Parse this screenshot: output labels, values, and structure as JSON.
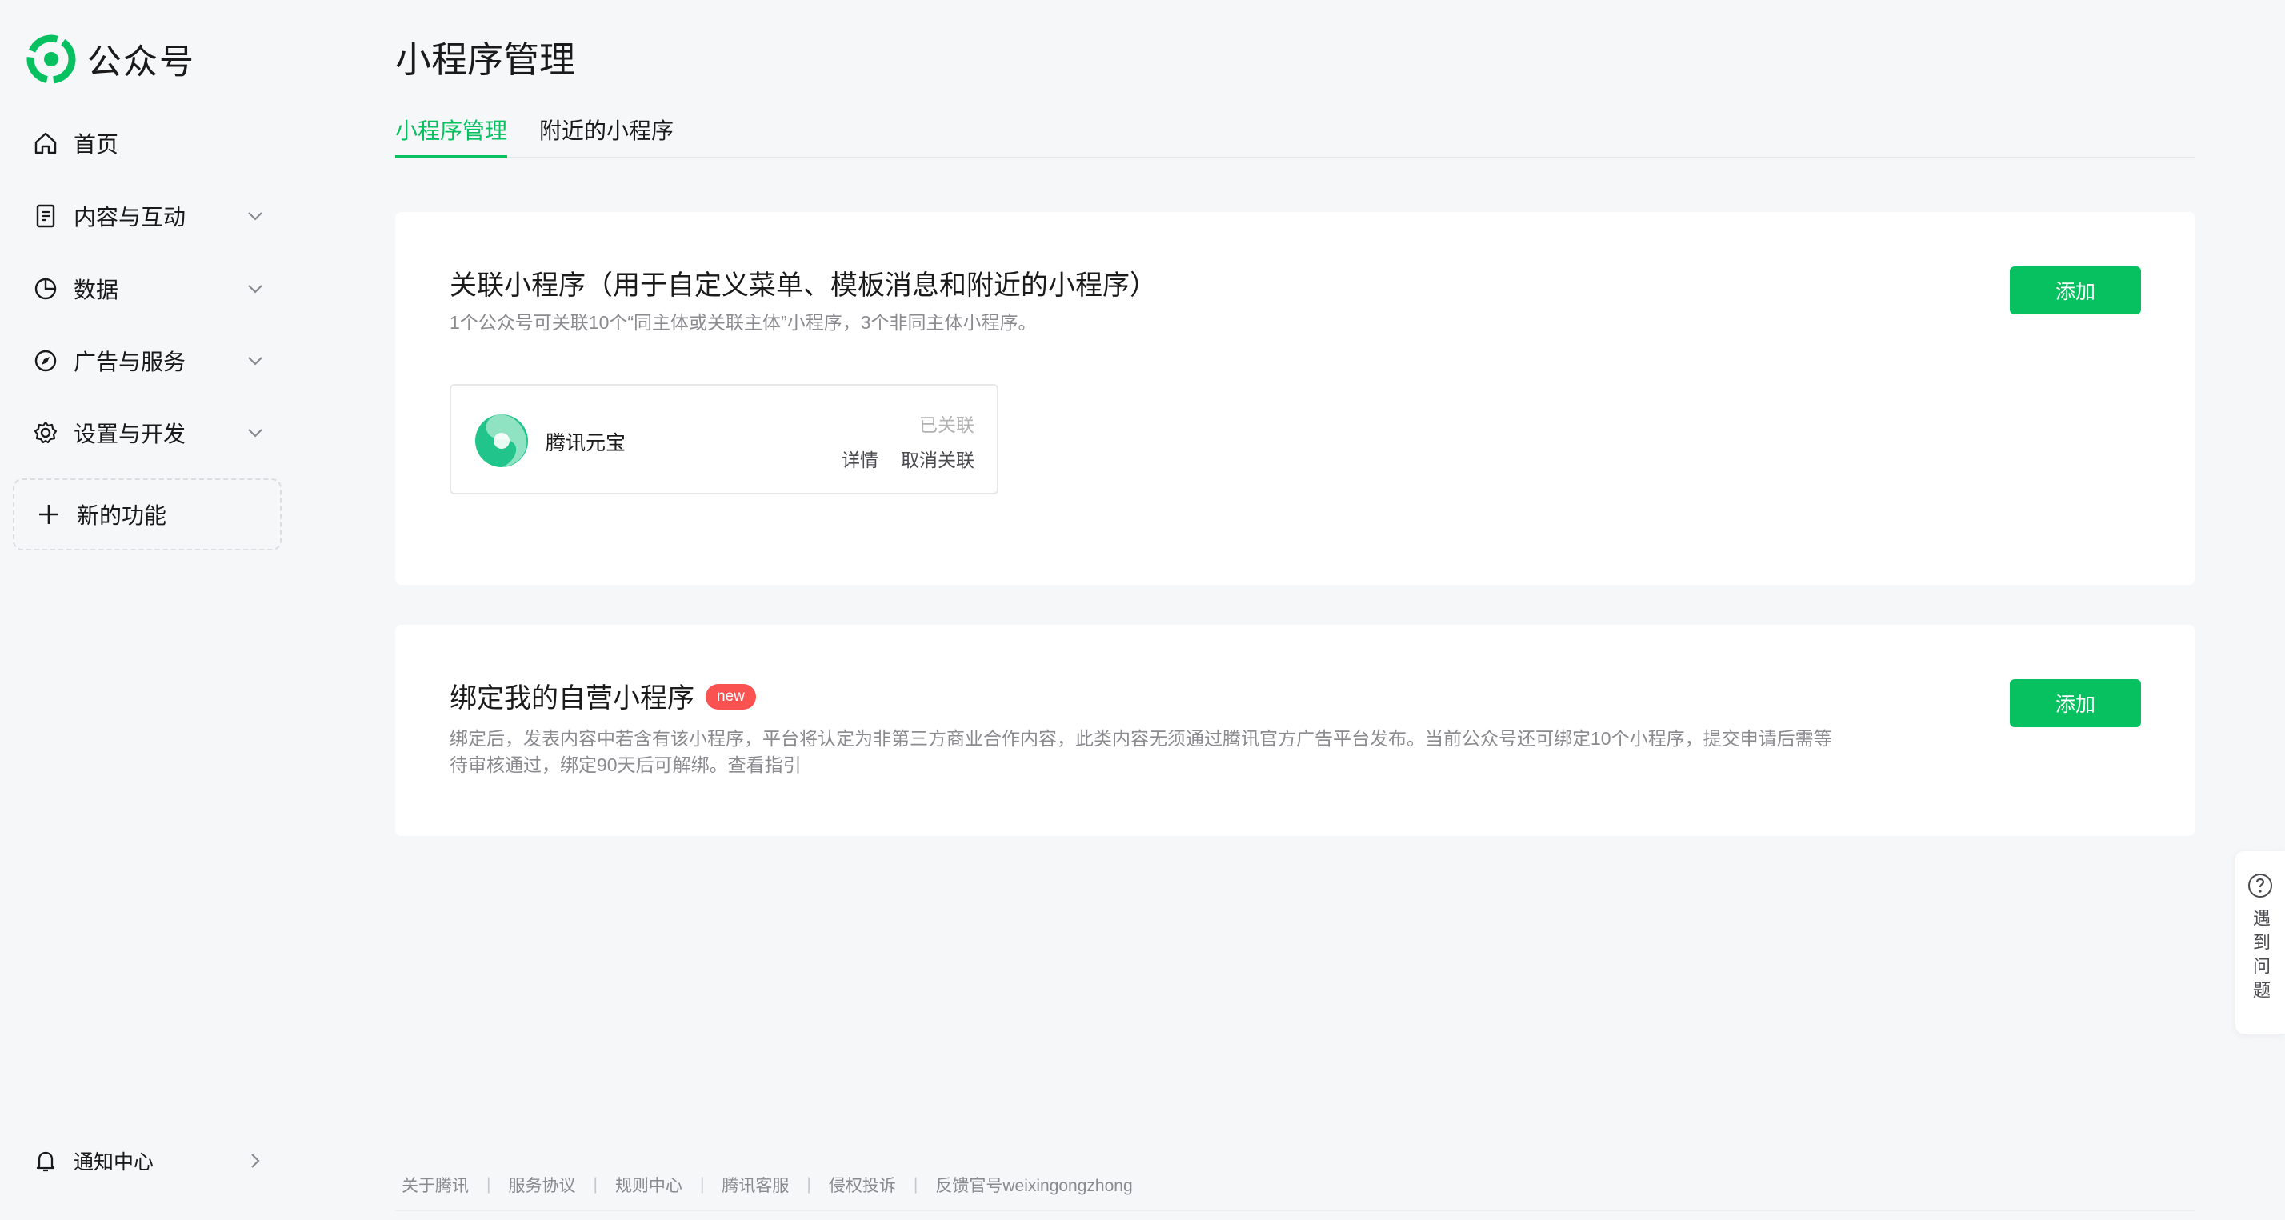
{
  "colors": {
    "accent": "#07c160",
    "badge": "#fa5151",
    "background": "#f6f7f9"
  },
  "brand": {
    "name": "公众号",
    "icon": "wechat-official-logo-icon"
  },
  "sidebar": {
    "items": [
      {
        "label": "首页",
        "icon": "home-icon",
        "expandable": false
      },
      {
        "label": "内容与互动",
        "icon": "document-icon",
        "expandable": true
      },
      {
        "label": "数据",
        "icon": "pie-chart-icon",
        "expandable": true
      },
      {
        "label": "广告与服务",
        "icon": "compass-icon",
        "expandable": true
      },
      {
        "label": "设置与开发",
        "icon": "gear-icon",
        "expandable": true
      }
    ],
    "new_feature": {
      "label": "新的功能",
      "icon": "plus-icon"
    },
    "notification": {
      "label": "通知中心",
      "icon": "bell-icon"
    }
  },
  "main": {
    "title": "小程序管理",
    "tabs": [
      {
        "label": "小程序管理",
        "active": true
      },
      {
        "label": "附近的小程序",
        "active": false
      }
    ],
    "card_linked": {
      "title": "关联小程序（用于自定义菜单、模板消息和附近的小程序）",
      "desc": "1个公众号可关联10个“同主体或关联主体”小程序，3个非同主体小程序。",
      "add_label": "添加",
      "item": {
        "name": "腾讯元宝",
        "status": "已关联",
        "detail_label": "详情",
        "unlink_label": "取消关联"
      }
    },
    "card_bind": {
      "title": "绑定我的自营小程序",
      "badge": "new",
      "desc_line1": "绑定后，发表内容中若含有该小程序，平台将认定为非第三方商业合作内容，此类内容无须通过腾讯官方广告平台发布。当前公众号还可绑定10个小程序，提交申请后需等",
      "desc_line2": "待审核通过，绑定90天后可解绑。查看指引",
      "add_label": "添加"
    }
  },
  "help": {
    "label": "遇到问题",
    "icon": "question-circle-icon"
  },
  "footer": {
    "links": [
      "关于腾讯",
      "服务协议",
      "规则中心",
      "腾讯客服",
      "侵权投诉",
      "反馈官号weixingongzhong"
    ],
    "separator": "|"
  }
}
